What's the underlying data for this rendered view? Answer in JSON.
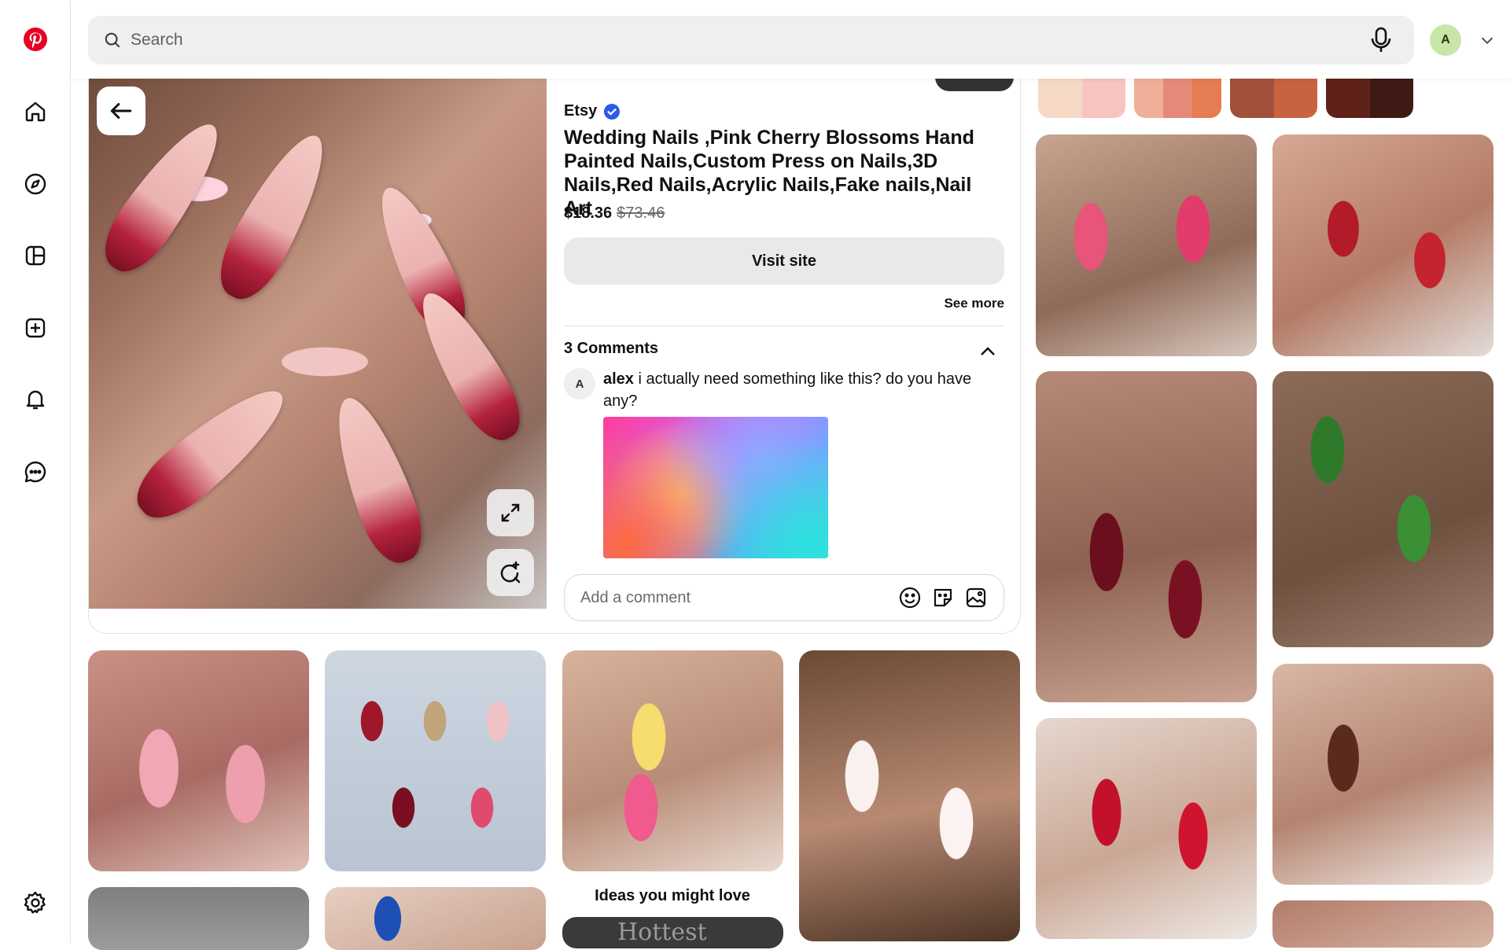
{
  "search": {
    "placeholder": "Search"
  },
  "account": {
    "initial": "A"
  },
  "pin": {
    "source": "Etsy",
    "title": "Wedding Nails ,Pink Cherry Blossoms Hand Painted Nails,Custom Press on Nails,3D Nails,Red Nails,Acrylic Nails,Fake nails,Nail Art",
    "price": "$18.36",
    "original_price": "$73.46",
    "visit_label": "Visit site",
    "see_more": "See more"
  },
  "comments": {
    "header": "3 Comments",
    "items": [
      {
        "avatar": "A",
        "author": "alex",
        "text": "i actually need something like this? do you have any?"
      }
    ],
    "add_placeholder": "Add a comment"
  },
  "sections": {
    "ideas_label": "Ideas you might love",
    "ideas_card_text": "Hottest"
  },
  "colors": {
    "brand_red": "#e60023",
    "verified_blue": "#2c5ae9",
    "swatches": [
      [
        "#f5d9c6",
        "#f8c4c0"
      ],
      [
        "#efb09a",
        "#e58a78",
        "#e67c52"
      ],
      [
        "#a1513a",
        "#c9633f"
      ],
      [
        "#5e2219",
        "#3f1a14"
      ]
    ]
  },
  "icons": [
    "pinterest-logo-icon",
    "home-icon",
    "explore-icon",
    "boards-icon",
    "create-icon",
    "notifications-icon",
    "messages-icon",
    "settings-icon",
    "search-icon",
    "microphone-icon",
    "chevron-down-icon",
    "back-arrow-icon",
    "expand-icon",
    "visual-search-icon",
    "verified-icon",
    "chevron-up-icon",
    "emoji-icon",
    "sticker-icon",
    "image-icon"
  ]
}
